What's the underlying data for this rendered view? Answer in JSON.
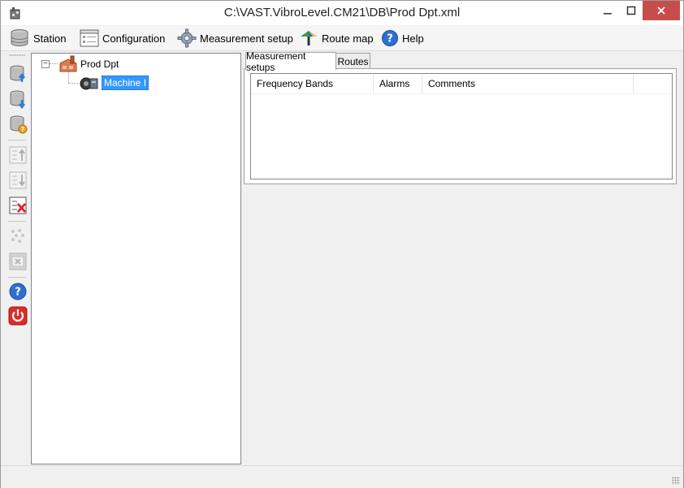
{
  "window": {
    "title": "C:\\VAST.VibroLevel.CM21\\DB\\Prod Dpt.xml"
  },
  "menubar": {
    "items": [
      {
        "label": "Station",
        "icon": "database-icon"
      },
      {
        "label": "Configuration",
        "icon": "configuration-icon"
      },
      {
        "label": "Measurement setup",
        "icon": "gear-icon"
      },
      {
        "label": "Route map",
        "icon": "route-map-icon"
      },
      {
        "label": "Help",
        "icon": "help-icon"
      }
    ]
  },
  "lefttoolbar": {
    "icons": [
      "database-upload-icon",
      "database-download-icon",
      "database-info-icon",
      "list-up-icon",
      "list-down-icon",
      "list-delete-icon",
      "points-icon",
      "report-icon",
      "help-icon",
      "power-icon"
    ]
  },
  "tree": {
    "root": {
      "label": "Prod Dpt",
      "icon": "factory-icon"
    },
    "child": {
      "label": "Machine I",
      "icon": "machine-icon"
    }
  },
  "tabs": [
    {
      "label": "Measurement setups",
      "active": true
    },
    {
      "label": "Routes",
      "active": false
    }
  ],
  "grid": {
    "columns": [
      "Frequency Bands",
      "Alarms",
      "Comments"
    ],
    "rows": []
  },
  "colors": {
    "selection": "#3399ff",
    "close_button": "#c74d4d"
  }
}
